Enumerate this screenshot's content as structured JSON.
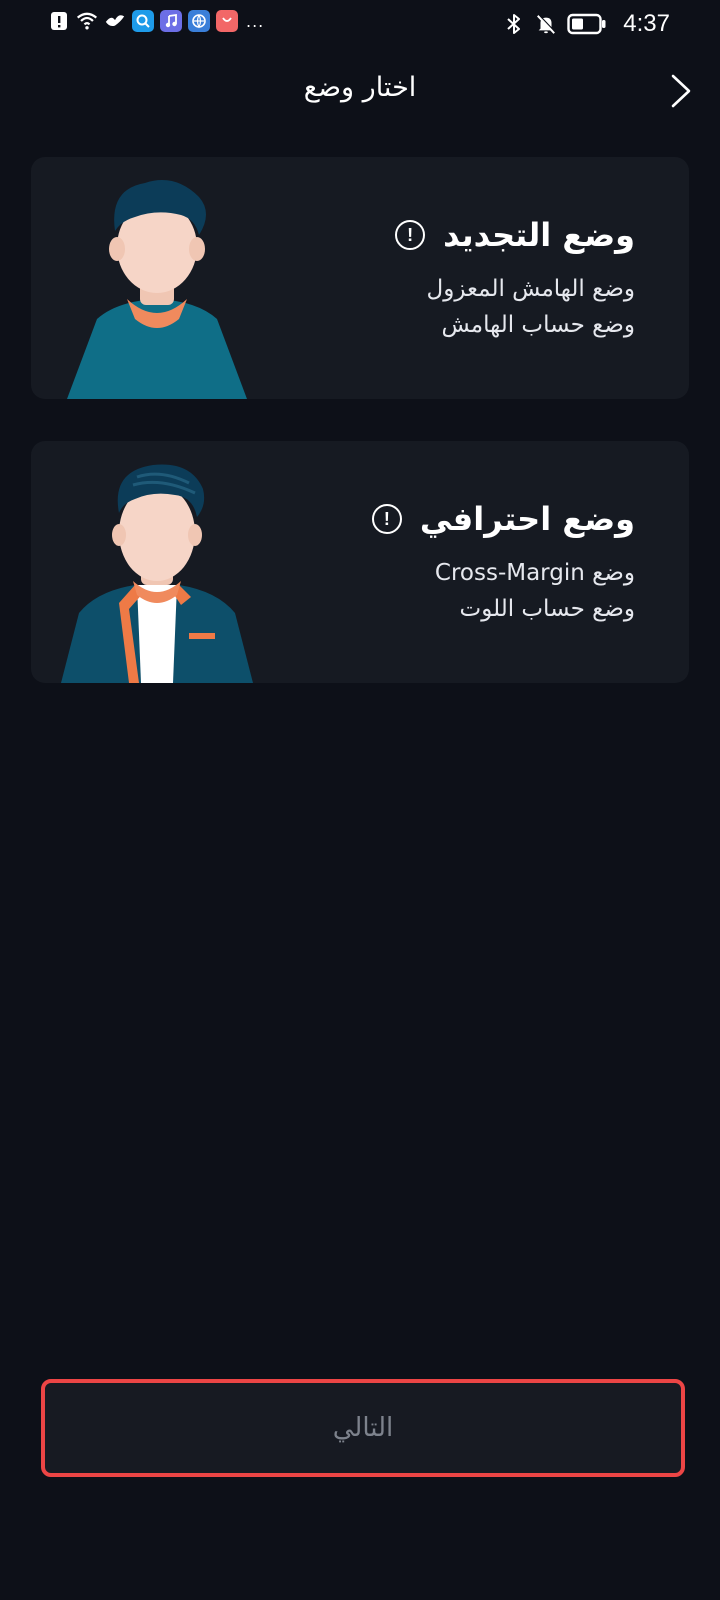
{
  "status_bar": {
    "time": "4:37",
    "icons_left": [
      "alert-icon",
      "wifi-icon",
      "bird-app-icon",
      "search-app-icon",
      "music-app-icon",
      "browser-app-icon",
      "store-app-icon"
    ],
    "more": "...",
    "icons_right": [
      "bluetooth-icon",
      "mute-icon",
      "battery-icon"
    ]
  },
  "header": {
    "title": "اختار وضع",
    "back_icon": "chevron-right-icon"
  },
  "cards": [
    {
      "title": "وضع التجديد",
      "lines": [
        "وضع الهامش المعزول",
        "وضع حساب الهامش"
      ],
      "info_icon": "info-icon",
      "info_glyph": "!"
    },
    {
      "title": "وضع احترافي",
      "lines": [
        "وضع Cross-Margin",
        "وضع حساب اللوت"
      ],
      "info_icon": "info-icon",
      "info_glyph": "!"
    }
  ],
  "next_button": {
    "label": "التالي"
  },
  "colors": {
    "background": "#0d1018",
    "card": "#161a22",
    "highlight_border": "#ec4545",
    "disabled_text": "#7d828c"
  }
}
